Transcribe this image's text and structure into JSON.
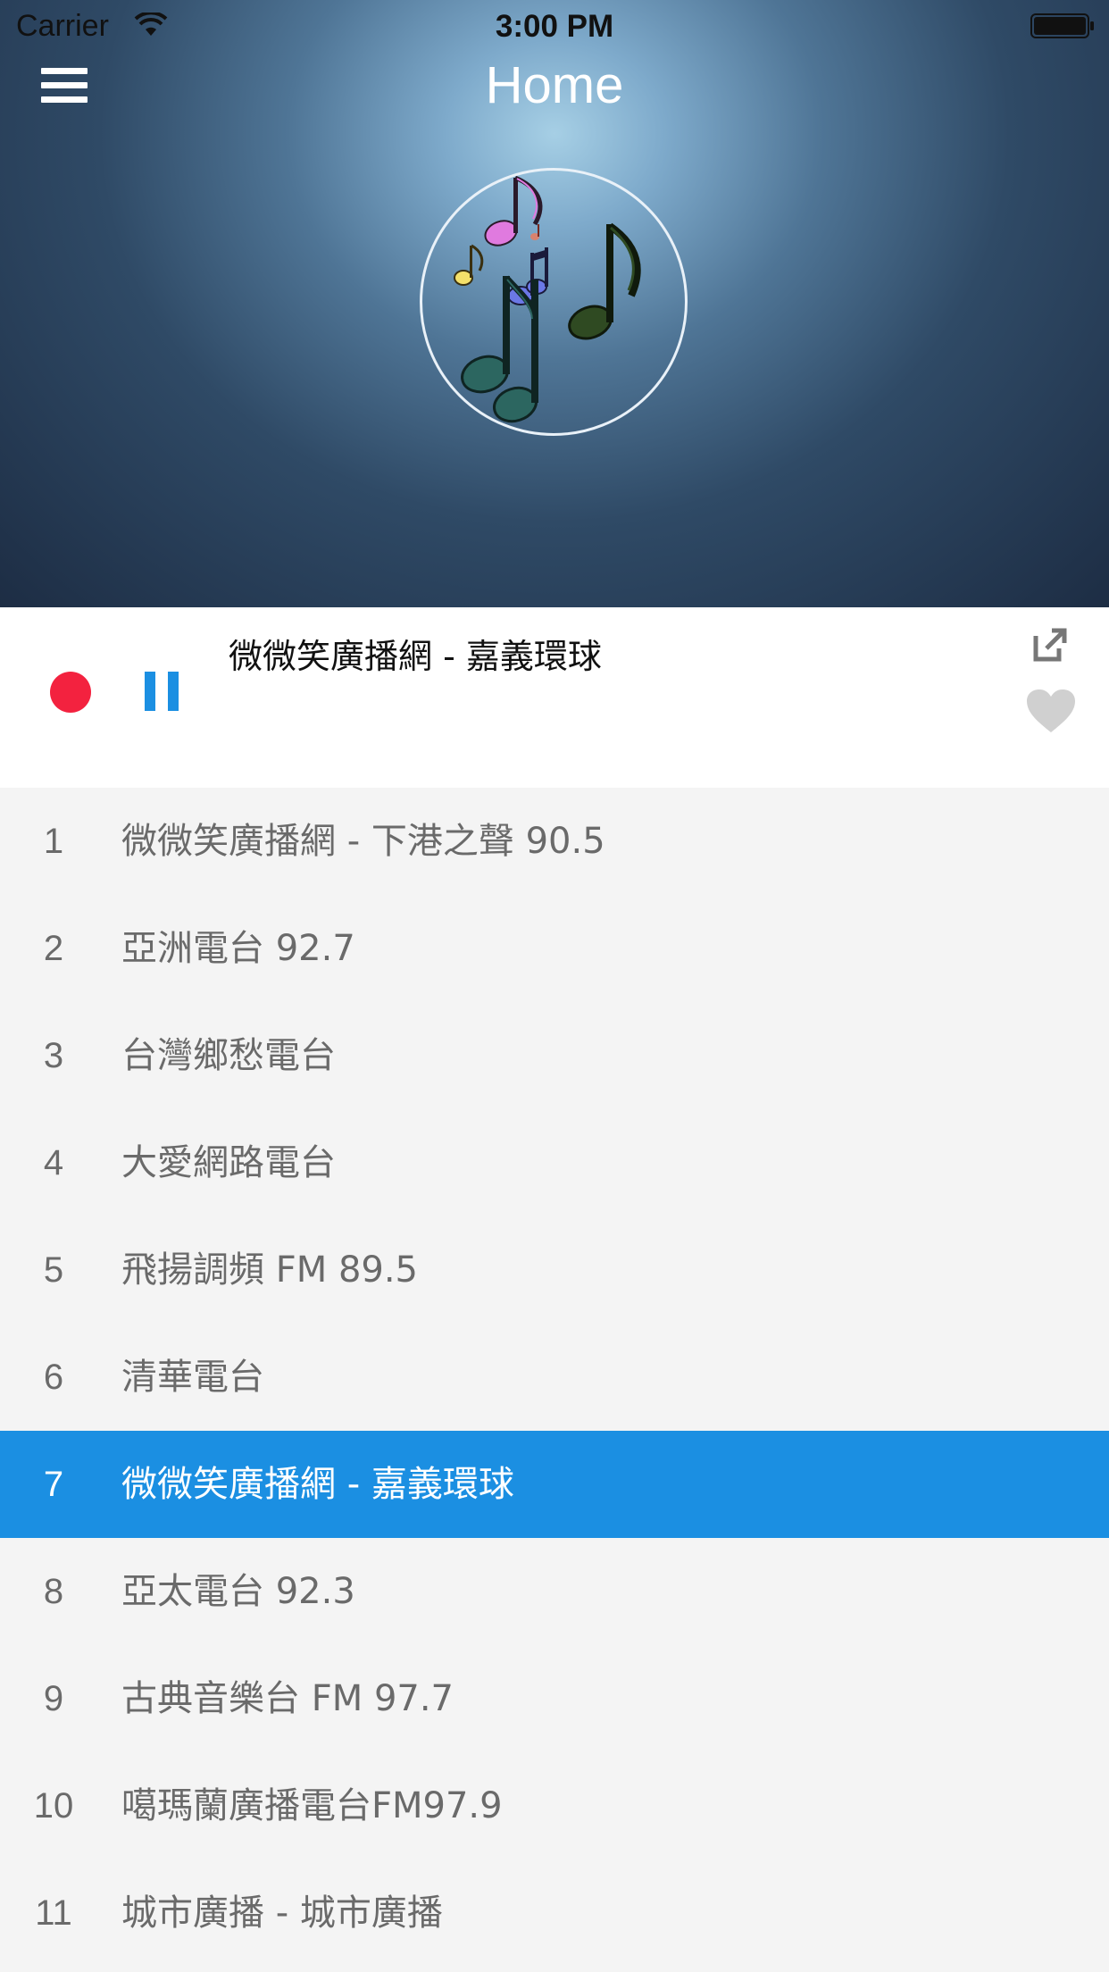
{
  "status_bar": {
    "carrier": "Carrier",
    "time": "3:00 PM"
  },
  "nav": {
    "title": "Home"
  },
  "player": {
    "now_playing": "微微笑廣播網 - 嘉義環球",
    "accent": "#1b8fe2",
    "record_color": "#f3223f"
  },
  "stations": [
    {
      "num": "1",
      "name": "微微笑廣播網 - 下港之聲 90.5",
      "active": false
    },
    {
      "num": "2",
      "name": "亞洲電台 92.7",
      "active": false
    },
    {
      "num": "3",
      "name": "台灣鄉愁電台",
      "active": false
    },
    {
      "num": "4",
      "name": "大愛網路電台",
      "active": false
    },
    {
      "num": "5",
      "name": "飛揚調頻 FM 89.5",
      "active": false
    },
    {
      "num": "6",
      "name": "清華電台",
      "active": false
    },
    {
      "num": "7",
      "name": "微微笑廣播網 - 嘉義環球",
      "active": true
    },
    {
      "num": "8",
      "name": "亞太電台 92.3",
      "active": false
    },
    {
      "num": "9",
      "name": "古典音樂台 FM 97.7",
      "active": false
    },
    {
      "num": "10",
      "name": "噶瑪蘭廣播電台FM97.9",
      "active": false
    },
    {
      "num": "11",
      "name": "城市廣播 - 城市廣播",
      "active": false
    }
  ]
}
